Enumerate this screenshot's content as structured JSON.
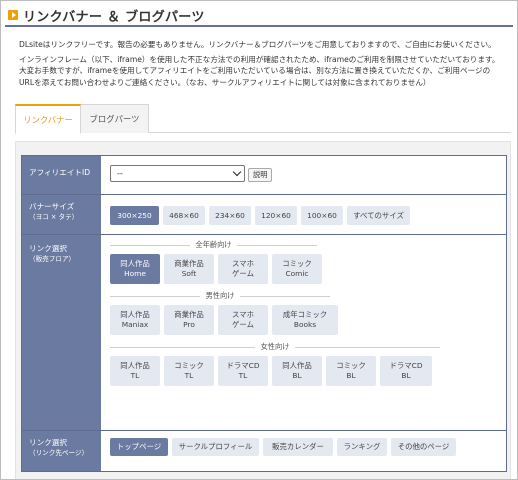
{
  "header": {
    "title": "リンクバナー ＆ ブログパーツ"
  },
  "intro": {
    "line1": "DLsiteはリンクフリーです。報告の必要もありません。リンクバナー＆ブログパーツをご用意しておりますので、ご自由にお使いください。",
    "line2": "インラインフレーム（以下、iframe）を使用した不正な方法での利用が確認されたため、iframeのご利用を制限させていただいております。",
    "line3": "大変お手数ですが、iframeを使用してアフィリエイトをご利用いただいている場合は、別な方法に置き換えていただくか、ご利用ページの",
    "line4": "URLを添えてお問い合わせよりご連絡ください。（なお、サークルアフィリエイトに関しては対象に含まれておりません）"
  },
  "tabs": [
    {
      "label": "リンクバナー",
      "active": true
    },
    {
      "label": "ブログパーツ",
      "active": false
    }
  ],
  "affiliate": {
    "label": "アフィリエイトID",
    "selected": "--",
    "explain_button": "説明"
  },
  "banner_size": {
    "label": "バナーサイズ",
    "sub": "（ヨコ × タテ）",
    "options": [
      "300×250",
      "468×60",
      "234×60",
      "120×60",
      "100×60",
      "すべてのサイズ"
    ],
    "selected_index": 0
  },
  "link_floor": {
    "label": "リンク選択",
    "sub": "（販売フロア）",
    "sections": [
      {
        "title": "全年齢向け",
        "items": [
          {
            "l1": "同人作品",
            "l2": "Home",
            "selected": true
          },
          {
            "l1": "商業作品",
            "l2": "Soft",
            "selected": false
          },
          {
            "l1": "スマホ",
            "l2": "ゲーム",
            "selected": false
          },
          {
            "l1": "コミック",
            "l2": "Comic",
            "selected": false
          }
        ]
      },
      {
        "title": "男性向け",
        "items": [
          {
            "l1": "同人作品",
            "l2": "Maniax",
            "selected": false
          },
          {
            "l1": "商業作品",
            "l2": "Pro",
            "selected": false
          },
          {
            "l1": "スマホ",
            "l2": "ゲーム",
            "selected": false
          },
          {
            "l1": "成年コミック",
            "l2": "Books",
            "selected": false
          }
        ]
      },
      {
        "title": "女性向け",
        "items": [
          {
            "l1": "同人作品",
            "l2": "TL",
            "selected": false
          },
          {
            "l1": "コミック",
            "l2": "TL",
            "selected": false
          },
          {
            "l1": "ドラマCD",
            "l2": "TL",
            "selected": false
          },
          {
            "l1": "同人作品",
            "l2": "BL",
            "selected": false
          },
          {
            "l1": "コミック",
            "l2": "BL",
            "selected": false
          },
          {
            "l1": "ドラマCD",
            "l2": "BL",
            "selected": false
          }
        ]
      }
    ]
  },
  "link_page": {
    "label": "リンク選択",
    "sub": "（リンク先ページ）",
    "options": [
      "トップページ",
      "サークルプロフィール",
      "販売カレンダー",
      "ランキング",
      "その他のページ"
    ],
    "selected_index": 0
  },
  "colors": {
    "accent": "#f0a000",
    "header_cell": "#6b7aa1",
    "chip": "#e4e8f1",
    "chip_selected": "#6b7aa1",
    "tab_active_text": "#e39b2b"
  }
}
